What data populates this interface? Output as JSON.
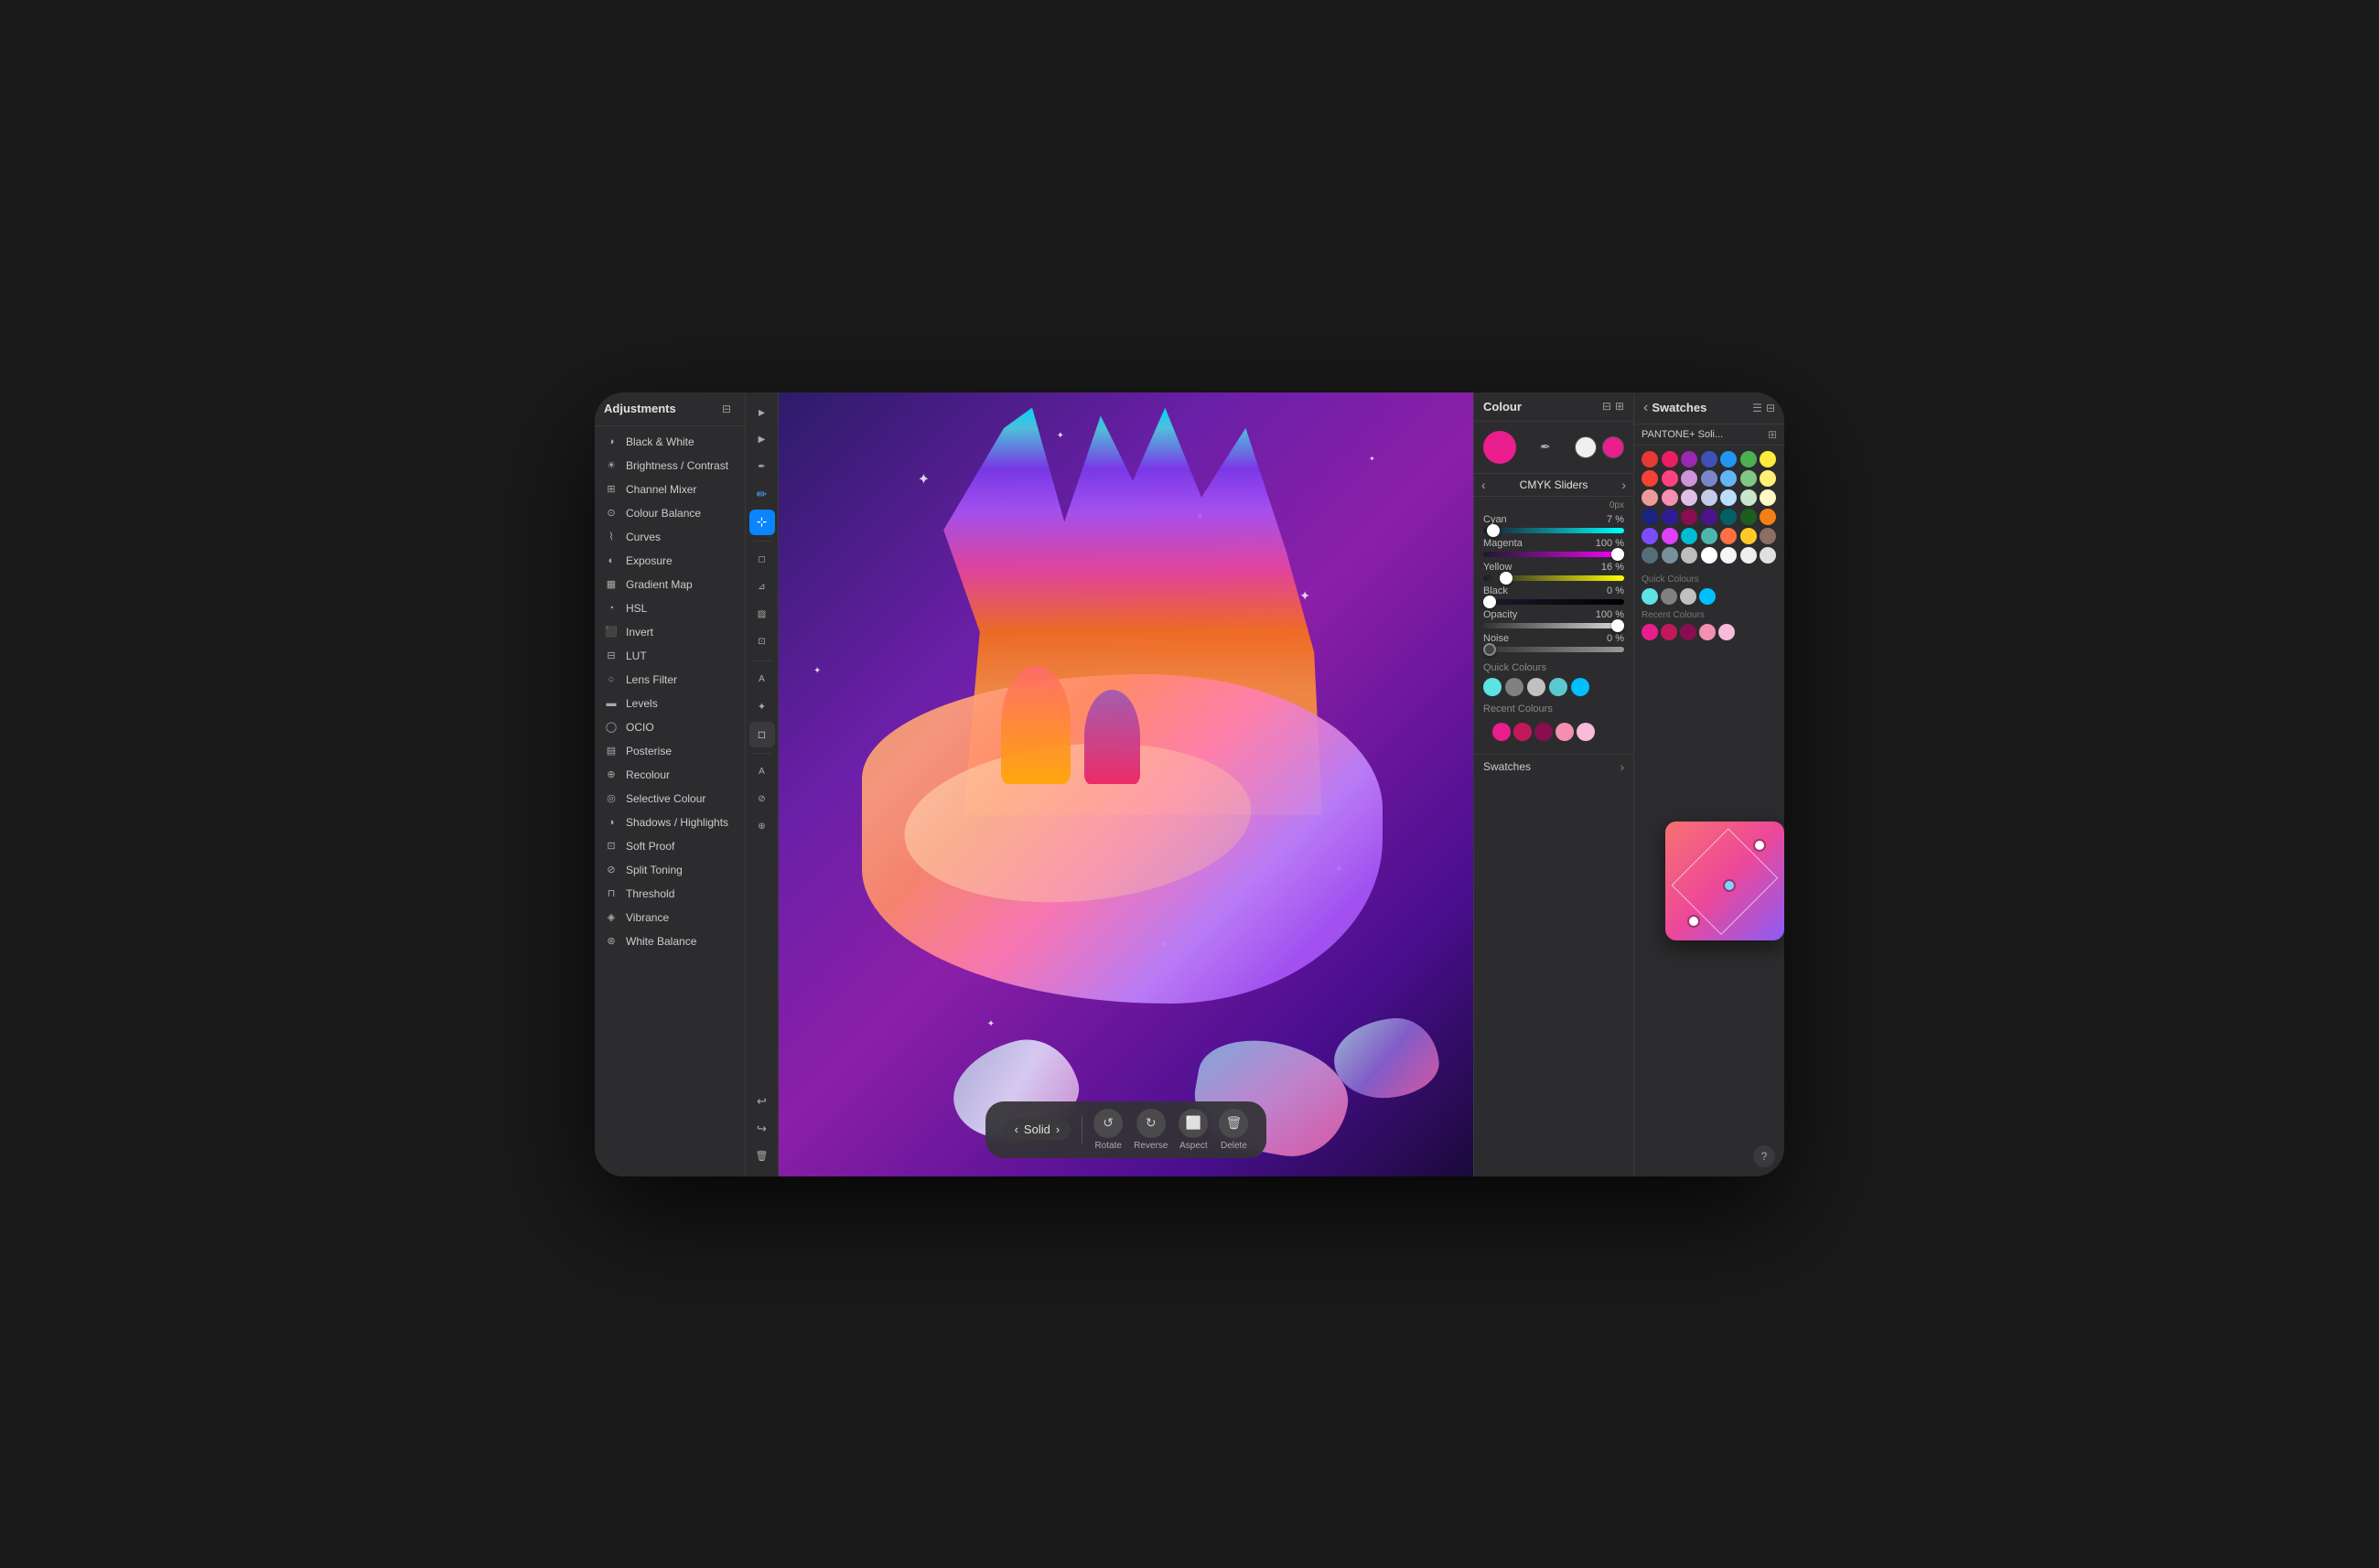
{
  "adjustments": {
    "title": "Adjustments",
    "items": [
      {
        "id": "black-white",
        "label": "Black & White",
        "icon": "◑"
      },
      {
        "id": "brightness-contrast",
        "label": "Brightness / Contrast",
        "icon": "☀"
      },
      {
        "id": "channel-mixer",
        "label": "Channel Mixer",
        "icon": "⊞"
      },
      {
        "id": "colour-balance",
        "label": "Colour Balance",
        "icon": "⊙"
      },
      {
        "id": "curves",
        "label": "Curves",
        "icon": "⌇"
      },
      {
        "id": "exposure",
        "label": "Exposure",
        "icon": "◐"
      },
      {
        "id": "gradient-map",
        "label": "Gradient Map",
        "icon": "▦"
      },
      {
        "id": "hsl",
        "label": "HSL",
        "icon": "◔"
      },
      {
        "id": "invert",
        "label": "Invert",
        "icon": "⬛"
      },
      {
        "id": "lut",
        "label": "LUT",
        "icon": "⊟"
      },
      {
        "id": "lens-filter",
        "label": "Lens Filter",
        "icon": "○"
      },
      {
        "id": "levels",
        "label": "Levels",
        "icon": "▬"
      },
      {
        "id": "ocio",
        "label": "OCIO",
        "icon": "◯"
      },
      {
        "id": "posterise",
        "label": "Posterise",
        "icon": "▤"
      },
      {
        "id": "recolour",
        "label": "Recolour",
        "icon": "⊕"
      },
      {
        "id": "selective-colour",
        "label": "Selective Colour",
        "icon": "◎"
      },
      {
        "id": "shadows-highlights",
        "label": "Shadows / Highlights",
        "icon": "◑"
      },
      {
        "id": "soft-proof",
        "label": "Soft Proof",
        "icon": "⊡"
      },
      {
        "id": "split-toning",
        "label": "Split Toning",
        "icon": "⊘"
      },
      {
        "id": "threshold",
        "label": "Threshold",
        "icon": "⊓"
      },
      {
        "id": "vibrance",
        "label": "Vibrance",
        "icon": "◈"
      },
      {
        "id": "white-balance",
        "label": "White Balance",
        "icon": "⊛"
      }
    ]
  },
  "canvas": {
    "nav_back": "←",
    "nav_save": "⬛",
    "nav_more": "···",
    "nav_layer": "⬡",
    "nav_grid": "⊞",
    "nav_transform": "⊟"
  },
  "bottom_toolbar": {
    "solid_label": "Solid",
    "rotate_label": "Rotate",
    "reverse_label": "Reverse",
    "aspect_label": "Aspect",
    "delete_label": "Delete"
  },
  "colour_panel": {
    "title": "Colour",
    "swatch_color": "#e91e8c",
    "swatch_secondary": "#e91e8c",
    "cmyk_label": "CMYK Sliders",
    "px_label": "0px",
    "sliders": {
      "cyan": {
        "label": "Cyan",
        "value": 7,
        "percent": "7 %",
        "fill_pct": 7
      },
      "magenta": {
        "label": "Magenta",
        "value": 100,
        "percent": "100 %",
        "fill_pct": 100
      },
      "yellow": {
        "label": "Yellow",
        "value": 16,
        "percent": "16 %",
        "fill_pct": 16
      },
      "black": {
        "label": "Black",
        "value": 0,
        "percent": "0 %",
        "fill_pct": 0
      },
      "opacity": {
        "label": "Opacity",
        "value": 100,
        "percent": "100 %",
        "fill_pct": 100
      },
      "noise": {
        "label": "Noise",
        "value": 0,
        "percent": "0 %",
        "fill_pct": 0
      }
    },
    "quick_colours_label": "Quick Colours",
    "quick_colours": [
      "#5de3e3",
      "#808080",
      "#c0c0c0",
      "#5bc8d0",
      "#00bfff"
    ],
    "recent_colours_label": "Recent Colours",
    "recent_colours": [
      "#e91e8c",
      "#c2185b",
      "#880e4f",
      "#f48fb1",
      "#f8bbd9"
    ],
    "swatches_label": "Swatches"
  },
  "swatches_panel": {
    "title": "Swatches",
    "nav_back": "‹",
    "nav_list": "☰",
    "pantone_label": "PANTONE+ Soli...",
    "grid_colors": [
      "#e53935",
      "#e91e63",
      "#9c27b0",
      "#3f51b5",
      "#2196f3",
      "#4caf50",
      "#ffeb3b",
      "#f44336",
      "#ff4081",
      "#ce93d8",
      "#7986cb",
      "#64b5f6",
      "#81c784",
      "#fff176",
      "#ef9a9a",
      "#f48fb1",
      "#e1bee7",
      "#c5cae9",
      "#bbdefb",
      "#c8e6c9",
      "#fff9c4",
      "#1a237e",
      "#311b92",
      "#880e4f",
      "#4a148c",
      "#006064",
      "#1b5e20",
      "#f57f17",
      "#7c4dff",
      "#e040fb",
      "#00bcd4",
      "#4db6ac",
      "#ff7043",
      "#ffca28",
      "#8d6e63",
      "#546e7a",
      "#78909c",
      "#bdbdbd",
      "#ffffff",
      "#f5f5f5",
      "#eeeeee",
      "#e0e0e0"
    ],
    "quick_colours_label": "Quick Colours",
    "quick_colours": [
      "#5de3e3",
      "#808080",
      "#c0c0c0",
      "#00bfff"
    ],
    "recent_colours_label": "Recent Colours",
    "recent_colours": [
      "#e91e8c",
      "#c2185b",
      "#880e4f",
      "#f48fb1",
      "#f8bbd9"
    ]
  }
}
